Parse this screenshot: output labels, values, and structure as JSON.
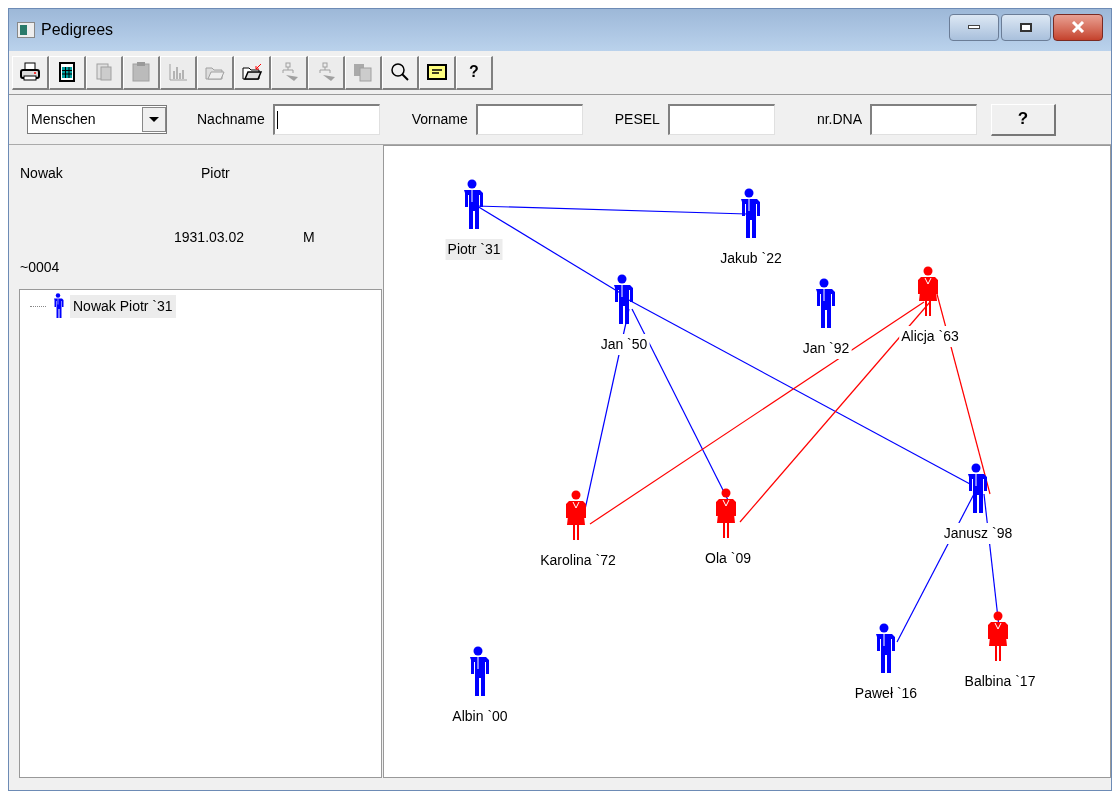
{
  "window": {
    "title": "Pedigrees"
  },
  "toolbar": [
    {
      "kind": "printer",
      "disabled": false
    },
    {
      "kind": "spreadsheet",
      "disabled": false
    },
    {
      "kind": "document",
      "disabled": true
    },
    {
      "kind": "clipboard",
      "disabled": true
    },
    {
      "kind": "chart",
      "disabled": true
    },
    {
      "kind": "folder",
      "disabled": true
    },
    {
      "kind": "folder-import",
      "disabled": false
    },
    {
      "kind": "tree",
      "disabled": true
    },
    {
      "kind": "tree",
      "disabled": true
    },
    {
      "kind": "copy",
      "disabled": true
    },
    {
      "kind": "search",
      "disabled": false
    },
    {
      "kind": "card",
      "disabled": false
    },
    {
      "kind": "help",
      "label": "?",
      "disabled": false
    }
  ],
  "filter": {
    "category": "Menschen",
    "fields": [
      {
        "label": "Nachname",
        "focused": true
      },
      {
        "label": "Vorname",
        "focused": false
      },
      {
        "label": "PESEL",
        "focused": false
      },
      {
        "label": "nr.DNA",
        "focused": false
      }
    ],
    "help_button": "?"
  },
  "details": {
    "surname": "Nowak",
    "first_name": "Piotr",
    "birth_date": "1931.03.02",
    "sex": "M",
    "id": "~0004"
  },
  "tree": [
    {
      "label": "Nowak Piotr `31",
      "kind": "male",
      "selected": true
    }
  ],
  "people": [
    {
      "label": "Piotr `31",
      "kind": "male",
      "selected": true
    },
    {
      "label": "Jakub `22",
      "kind": "male",
      "selected": false
    },
    {
      "label": "Jan `50",
      "kind": "male",
      "selected": false
    },
    {
      "label": "Jan `92",
      "kind": "male",
      "selected": false
    },
    {
      "label": "Alicja `63",
      "kind": "female",
      "selected": false
    },
    {
      "label": "Karolina `72",
      "kind": "female",
      "selected": false
    },
    {
      "label": "Ola `09",
      "kind": "female",
      "selected": false
    },
    {
      "label": "Janusz `98",
      "kind": "male",
      "selected": false
    },
    {
      "label": "Paweł `16",
      "kind": "male",
      "selected": false
    },
    {
      "label": "Balbina `17",
      "kind": "female",
      "selected": false
    },
    {
      "label": "Albin `00",
      "kind": "male",
      "selected": false
    }
  ]
}
